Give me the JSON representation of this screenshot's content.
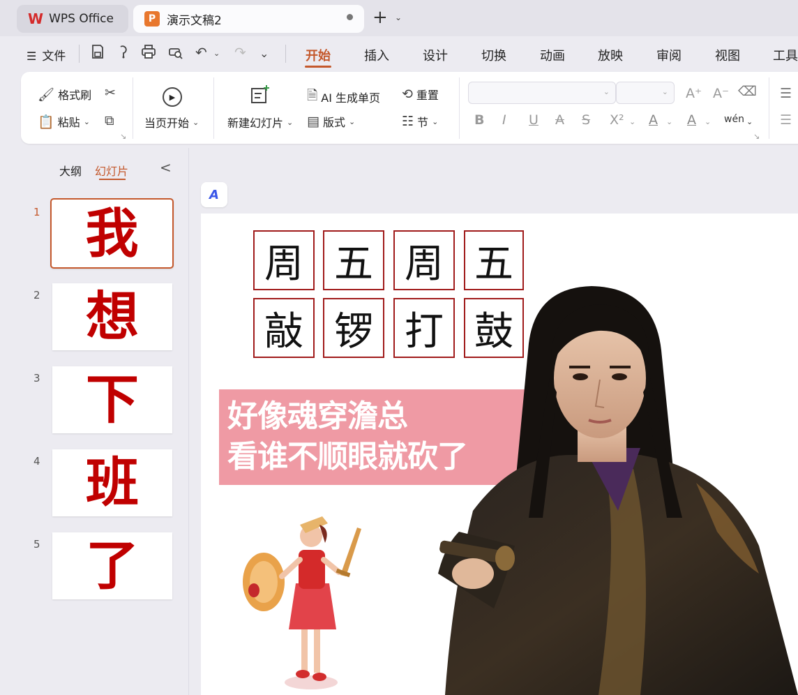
{
  "tabs": {
    "wps_label": "WPS Office",
    "doc_label": "演示文稿2",
    "doc_icon_letter": "P",
    "add_symbol": "+"
  },
  "menu": {
    "file_label": "文件",
    "items": [
      "开始",
      "插入",
      "设计",
      "切换",
      "动画",
      "放映",
      "审阅",
      "视图",
      "工具"
    ],
    "active": "开始"
  },
  "ribbon": {
    "format_painter": "格式刷",
    "paste": "粘贴",
    "play_from_current": "当页开始",
    "new_slide": "新建幻灯片",
    "ai_single_page": "AI 生成单页",
    "layout": "版式",
    "reset": "重置",
    "section": "节",
    "bold": "B",
    "italic": "I",
    "underline": "U",
    "strikethrough": "A",
    "shadow": "S",
    "superscript": "X²",
    "font_color": "A",
    "highlight": "A",
    "phonetic": "wén",
    "font_grow": "A⁺",
    "font_shrink": "A⁻"
  },
  "panel": {
    "outline_tab": "大纲",
    "slides_tab": "幻灯片",
    "collapse": "<",
    "slides": [
      {
        "num": "1",
        "char": "我"
      },
      {
        "num": "2",
        "char": "想"
      },
      {
        "num": "3",
        "char": "下"
      },
      {
        "num": "4",
        "char": "班"
      },
      {
        "num": "5",
        "char": "了"
      }
    ]
  },
  "slide": {
    "grid_row1": [
      "周",
      "五",
      "周",
      "五"
    ],
    "grid_row2": [
      "敲",
      "锣",
      "打",
      "鼓"
    ],
    "caption_line1": "好像魂穿澹总",
    "caption_line2": "看谁不顺眼就砍了",
    "ai_badge": "A"
  },
  "colors": {
    "accent": "#c4582c",
    "slide_char": "#c00000",
    "grid_border": "#a01a1a",
    "caption_bg": "#ef9aa4"
  }
}
